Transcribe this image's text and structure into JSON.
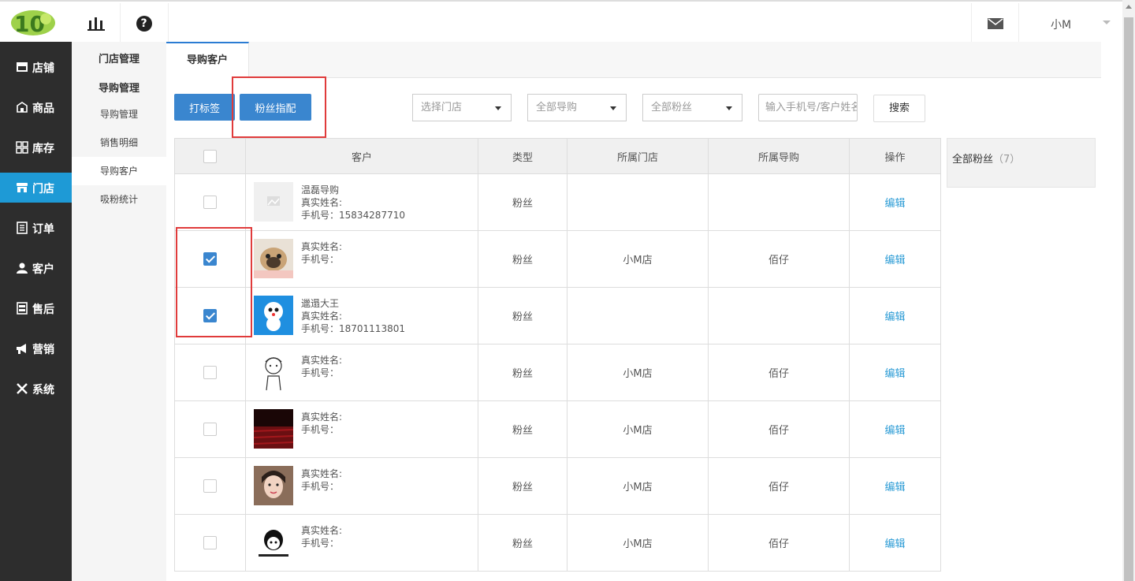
{
  "header": {
    "user_name": "小M",
    "icons": [
      "chart-icon",
      "help-icon",
      "mail-icon"
    ],
    "help_glyph": "?"
  },
  "sidebar": {
    "items": [
      {
        "label": "店铺",
        "icon": "store-icon"
      },
      {
        "label": "商品",
        "icon": "goods-icon"
      },
      {
        "label": "库存",
        "icon": "inventory-icon"
      },
      {
        "label": "门店",
        "icon": "shop-icon",
        "active": true
      },
      {
        "label": "订单",
        "icon": "order-icon"
      },
      {
        "label": "客户",
        "icon": "customer-icon"
      },
      {
        "label": "售后",
        "icon": "aftersale-icon"
      },
      {
        "label": "营销",
        "icon": "marketing-icon"
      },
      {
        "label": "系统",
        "icon": "system-icon"
      }
    ]
  },
  "subsidebar": {
    "heading1": "门店管理",
    "heading2": "导购管理",
    "items": [
      {
        "label": "导购管理"
      },
      {
        "label": "销售明细"
      },
      {
        "label": "导购客户",
        "active": true
      },
      {
        "label": "吸粉统计"
      }
    ]
  },
  "tabs": [
    {
      "label": "导购客户",
      "active": true
    }
  ],
  "toolbar": {
    "tag_button": "打标签",
    "assign_button": "粉丝指配",
    "store_select": "选择门店",
    "guide_select": "全部导购",
    "fans_select": "全部粉丝",
    "search_placeholder": "输入手机号/客户姓名",
    "search_button": "搜索"
  },
  "table": {
    "headers": [
      "客户",
      "类型",
      "所属门店",
      "所属导购",
      "操作"
    ],
    "rows": [
      {
        "checked": false,
        "nickname": "温磊导购",
        "real_name": "真实姓名:",
        "phone": "手机号：15834287710",
        "type": "粉丝",
        "store": "",
        "guide": "",
        "action": "编辑",
        "avatar": "placeholder"
      },
      {
        "checked": true,
        "nickname": "",
        "real_name": "真实姓名:",
        "phone": "手机号：",
        "type": "粉丝",
        "store": "小M店",
        "guide": "佰仔",
        "action": "编辑",
        "avatar": "dog"
      },
      {
        "checked": true,
        "nickname": "邋遢大王",
        "real_name": "真实姓名:",
        "phone": "手机号：18701113801",
        "type": "粉丝",
        "store": "",
        "guide": "",
        "action": "编辑",
        "avatar": "cartoon-blue"
      },
      {
        "checked": false,
        "nickname": "",
        "real_name": "真实姓名:",
        "phone": "手机号：",
        "type": "粉丝",
        "store": "小M店",
        "guide": "佰仔",
        "action": "编辑",
        "avatar": "sketch"
      },
      {
        "checked": false,
        "nickname": "",
        "real_name": "真实姓名:",
        "phone": "手机号：",
        "type": "粉丝",
        "store": "小M店",
        "guide": "佰仔",
        "action": "编辑",
        "avatar": "theater"
      },
      {
        "checked": false,
        "nickname": "",
        "real_name": "真实姓名:",
        "phone": "手机号：",
        "type": "粉丝",
        "store": "小M店",
        "guide": "佰仔",
        "action": "编辑",
        "avatar": "portrait"
      },
      {
        "checked": false,
        "nickname": "",
        "real_name": "真实姓名:",
        "phone": "手机号：",
        "type": "粉丝",
        "store": "小M店",
        "guide": "佰仔",
        "action": "编辑",
        "avatar": "meme"
      }
    ]
  },
  "right_panel": {
    "label": "全部粉丝",
    "count": "（7）"
  },
  "colors": {
    "accent": "#3a86cf",
    "sidebar_bg": "#2d2d2d",
    "active_nav": "#1e9ad6",
    "highlight_box": "#e03b3b",
    "link": "#2a9bd5"
  }
}
